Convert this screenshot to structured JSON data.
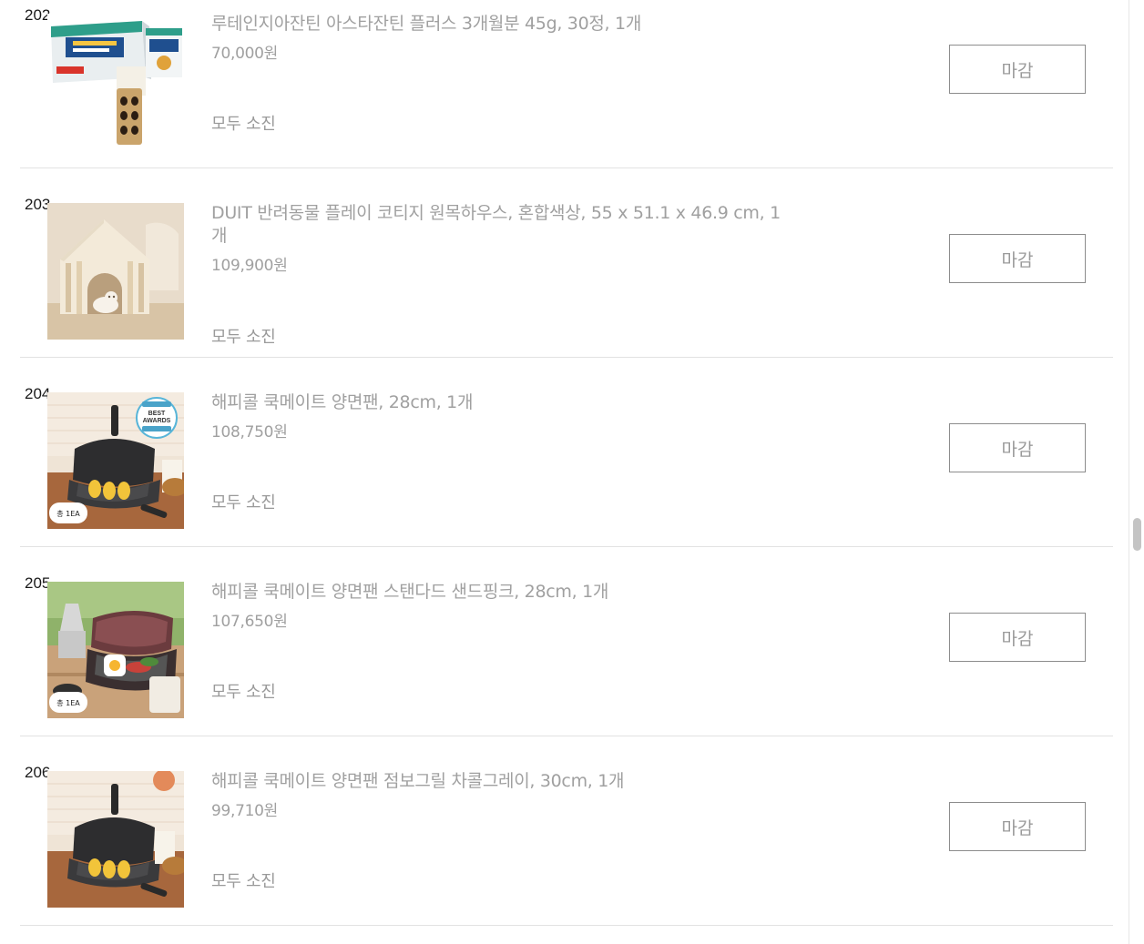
{
  "items": [
    {
      "no": "202",
      "title": "루테인지아잔틴 아스타잔틴 플러스 3개월분 45g, 30정, 1개",
      "price": "70,000원",
      "status": "모두 소진",
      "button": "마감",
      "thumb_kind": "supplement-box"
    },
    {
      "no": "203",
      "title": "DUIT 반려동물 플레이 코티지 원목하우스, 혼합색상, 55 x 51.1 x 46.9 cm, 1개",
      "price": "109,900원",
      "status": "모두 소진",
      "button": "마감",
      "thumb_kind": "pet-house"
    },
    {
      "no": "204",
      "title": "해피콜 쿡메이트 양면팬, 28cm, 1개",
      "price": "108,750원",
      "status": "모두 소진",
      "button": "마감",
      "thumb_kind": "pan-corn",
      "badge_text": "총 1EA",
      "award_lines": [
        "BEST",
        "AWARDS"
      ]
    },
    {
      "no": "205",
      "title": "해피콜 쿡메이트 양면팬 스탠다드 샌드핑크, 28cm, 1개",
      "price": "107,650원",
      "status": "모두 소진",
      "button": "마감",
      "thumb_kind": "pan-pink",
      "badge_text": "총 1EA"
    },
    {
      "no": "206",
      "title": "해피콜 쿡메이트 양면팬 점보그릴 차콜그레이, 30cm, 1개",
      "price": "99,710원",
      "status": "모두 소진",
      "button": "마감",
      "thumb_kind": "pan-corn-plain"
    }
  ],
  "colors": {
    "text_muted": "#a0a0a0",
    "border": "#8c8c8c",
    "divider": "#e2e2e2"
  }
}
